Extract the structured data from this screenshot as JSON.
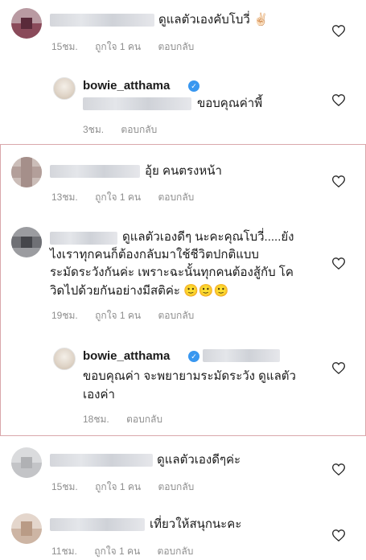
{
  "comments": [
    {
      "text": "ดูแลตัวเองคับโบวี่ ✌🏻",
      "time": "15ชม.",
      "likes": "ถูกใจ 1 คน",
      "reply": "ตอบกลับ",
      "reply_comment": {
        "username": "bowie_atthama",
        "text": "ขอบคุณค่าพี้",
        "time": "3ชม.",
        "reply": "ตอบกลับ"
      }
    },
    {
      "text": "อุ้ย คนตรงหน้า",
      "time": "13ชม.",
      "likes": "ถูกใจ 1 คน",
      "reply": "ตอบกลับ"
    },
    {
      "text_lines": [
        "ดูแลตัวเองดีๆ นะคะคุณโบวี่.....ยัง",
        "ไงเราทุกคนก็ต้องกลับมาใช้ชีวิตปกติแบบ",
        "ระมัดระวังกันค่ะ เพราะฉะนั้นทุกคนต้องสู้กับ โค",
        "วิดไปด้วยกันอย่างมีสติค่ะ 🙂🙂🙂"
      ],
      "time": "19ชม.",
      "likes": "ถูกใจ 1 คน",
      "reply": "ตอบกลับ",
      "reply_comment": {
        "username": "bowie_atthama",
        "text_lines": [
          "ขอบคุณค่า จะพยายามระมัดระวัง ดูแลตัว",
          "เองค่า"
        ],
        "time": "18ชม.",
        "reply": "ตอบกลับ"
      }
    },
    {
      "text": "ดูแลตัวเองดีๆค่ะ",
      "time": "15ชม.",
      "likes": "ถูกใจ 1 คน",
      "reply": "ตอบกลับ"
    },
    {
      "text": "เที่ยวให้สนุกนะคะ",
      "time": "11ชม.",
      "likes": "ถูกใจ 1 คน",
      "reply": "ตอบกลับ"
    }
  ],
  "verified_badge": "✓",
  "colors": {
    "highlight_border": "#d9a7ab",
    "verified": "#3897f0",
    "meta": "#8e8e8e"
  },
  "icons": {
    "like": "heart-icon",
    "verified": "verified-badge-icon"
  }
}
